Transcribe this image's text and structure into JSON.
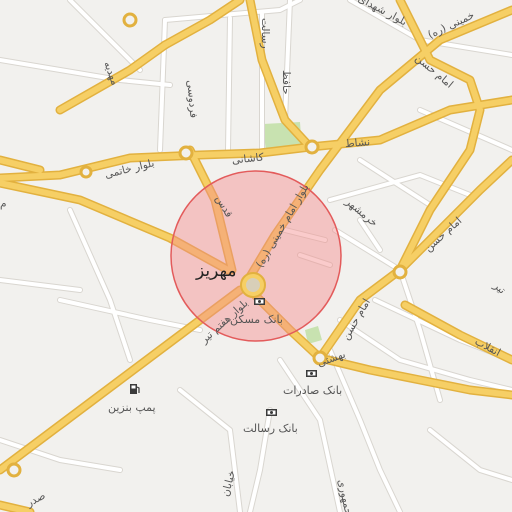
{
  "map": {
    "city_name": "مهریز",
    "colors": {
      "background": "#f2f1ee",
      "major_road": "#f6cf65",
      "major_road_casing": "#e2b13f",
      "minor_road": "#ffffff",
      "minor_road_casing": "#d9d6d0",
      "park": "#c8e2b0",
      "highlight_fill": "#f48c8c",
      "highlight_stroke": "#e35b5b",
      "icon_dark": "#3b3b3b"
    },
    "streets": {
      "shahida_blvd": "بلوار شهدای",
      "khomeini_top": "خمینی (ره)",
      "rasalat": "رسالت",
      "mahdieh": "مهدیه",
      "ferdowsi": "فردوسی",
      "hafez": "حافظ",
      "imam_hasan_1": "امام حسن",
      "imam_hasan_2": "امام حسن",
      "imam_hasan_3": "امام حسن",
      "khatami_blvd": "بلوار خاتمی",
      "kashani": "کاشانی",
      "neshat": "نشاط",
      "imam_khomeini_blvd": "بلوار امام خمینی (ره)",
      "qods": "قدس",
      "khorramshahr": "خرمشهر",
      "haftom_tir_blvd": "بلوار هفتم تیر",
      "beheshti": "بهشتی",
      "enghelab": "انقلاب",
      "tir": "تیر",
      "khayaban": "خیابان",
      "jomhouri": "جمهوری",
      "mim": "م",
      "sadr": "صدر"
    },
    "pois": {
      "bank_maskan": "بانک مسکن",
      "bank_saderat": "بانک صادرات",
      "bank_resalat": "بانک رسالت",
      "gas_station": "پمپ بنزین"
    },
    "icons": {
      "bank": "bank-icon",
      "fuel": "fuel-pump-icon",
      "center": "city-center-marker"
    }
  }
}
